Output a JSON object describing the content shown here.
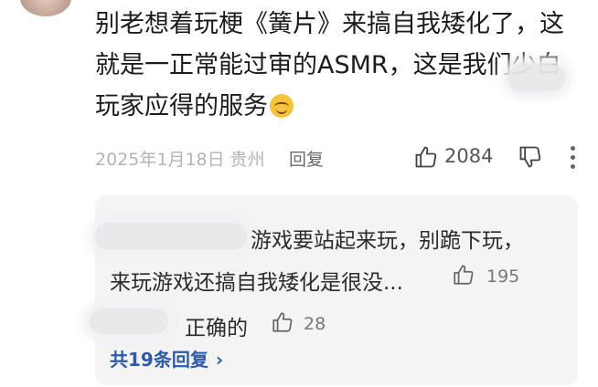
{
  "comment": {
    "text": "别老想着玩梗《簧片》来搞自我矮化了，这就是一正常能过审的ASMR，这是我们少白玩家应得的服务",
    "emoji": "smiling-face-icon",
    "date": "2025年1月18日",
    "location": "贵州",
    "reply_label": "回复",
    "like_count": "2084"
  },
  "replies": [
    {
      "line1": "游戏要站起来玩，别跪下玩，",
      "line2": "来玩游戏还搞自我矮化是很没...",
      "like_count": "195"
    },
    {
      "text": "正确的",
      "like_count": "28"
    }
  ],
  "view_all": {
    "label": "共19条回复"
  },
  "colors": {
    "meta": "#b4b4b4",
    "link": "#2f5aa8",
    "reply_bg": "#f4f4f5"
  }
}
